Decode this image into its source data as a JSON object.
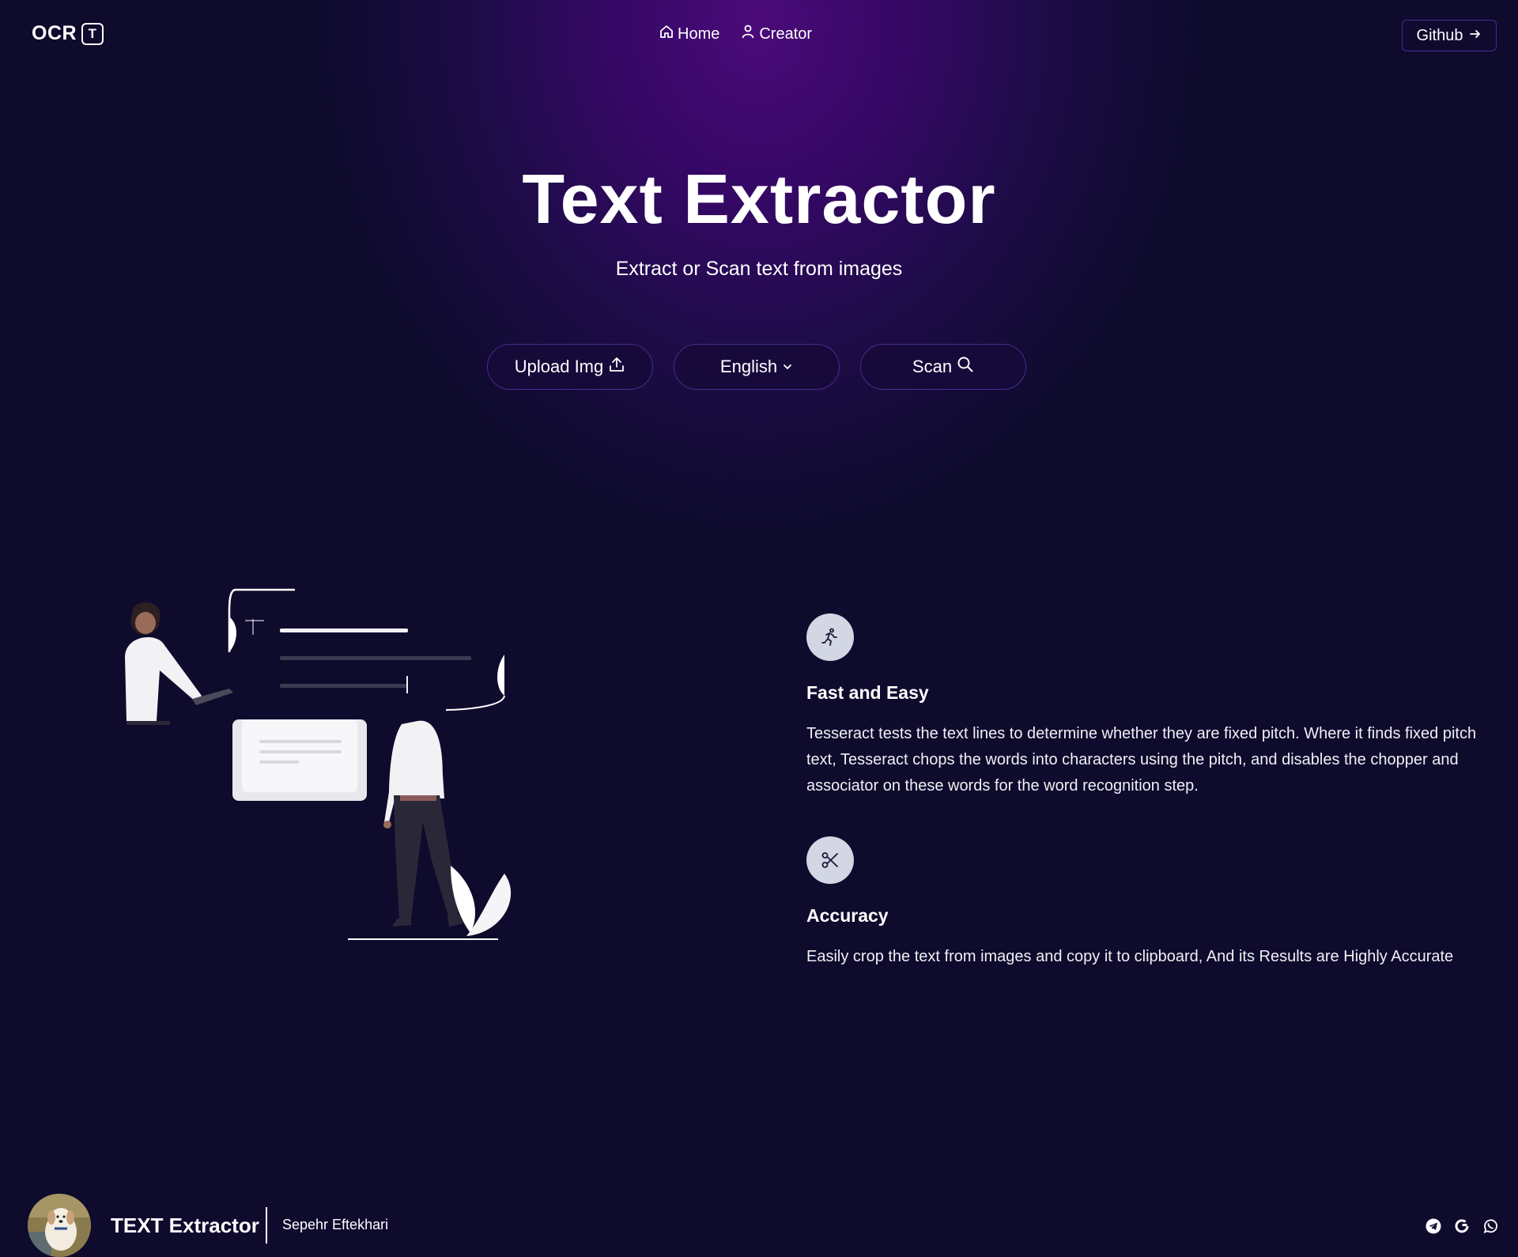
{
  "nav": {
    "logo_text": "OCR",
    "logo_badge": "T",
    "links": [
      {
        "label": "Home",
        "icon": "home-icon"
      },
      {
        "label": "Creator",
        "icon": "user-icon"
      }
    ],
    "github_label": "Github"
  },
  "hero": {
    "title": "Text Extractor",
    "subtitle": "Extract or Scan text from images",
    "buttons": {
      "upload": "Upload Img",
      "language": "English",
      "scan": "Scan"
    }
  },
  "features": [
    {
      "icon": "running-person-icon",
      "title": "Fast and Easy",
      "text": "Tesseract tests the text lines to determine whether they are fixed pitch. Where it finds fixed pitch text, Tesseract chops the words into characters using the pitch, and disables the chopper and associator on these words for the word recognition step."
    },
    {
      "icon": "scissors-icon",
      "title": "Accuracy",
      "text": "Easily crop the text from images and copy it to clipboard, And its Results are Highly Accurate"
    }
  ],
  "footer": {
    "brand": "TEXT Extractor",
    "author": "Sepehr Eftekhari",
    "socials": [
      "telegram-icon",
      "google-icon",
      "whatsapp-icon"
    ]
  },
  "colors": {
    "background": "#0e0b2d",
    "glow": "#4b0a7a",
    "button_border": "#4a2a8c",
    "icon_circle": "#d3d6e3"
  }
}
